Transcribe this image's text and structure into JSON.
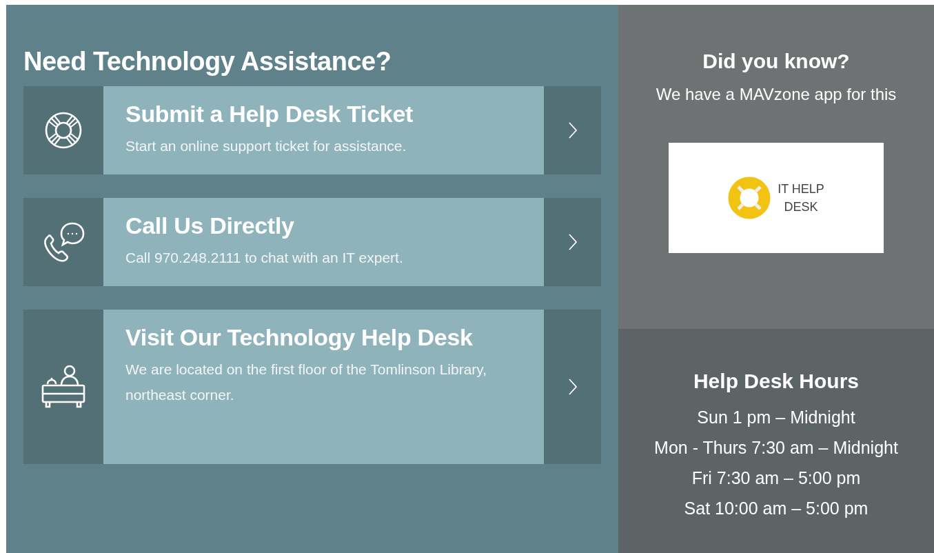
{
  "heading": "Need Technology Assistance?",
  "cards": [
    {
      "kind": "lifebuoy",
      "title": "Submit a Help Desk Ticket",
      "description": "Start an online support ticket for assistance."
    },
    {
      "kind": "phone-chat",
      "title": "Call Us Directly",
      "description": "Call 970.248.2111 to chat with an IT expert."
    },
    {
      "kind": "desk",
      "title": "Visit Our Technology Help Desk",
      "description": "We are located on the first floor of the Tomlinson Library, northeast corner."
    }
  ],
  "did_you_know": {
    "title": "Did you know?",
    "text": "We have a MAVzone app for this",
    "logo_text": [
      "IT HELP",
      "DESK"
    ]
  },
  "hours": {
    "title": "Help Desk Hours",
    "lines": [
      "Sun 1 pm – Midnight",
      "Mon - Thurs 7:30 am – Midnight",
      "Fri 7:30 am – 5:00 pm",
      "Sat 10:00 am – 5:00 pm"
    ]
  }
}
